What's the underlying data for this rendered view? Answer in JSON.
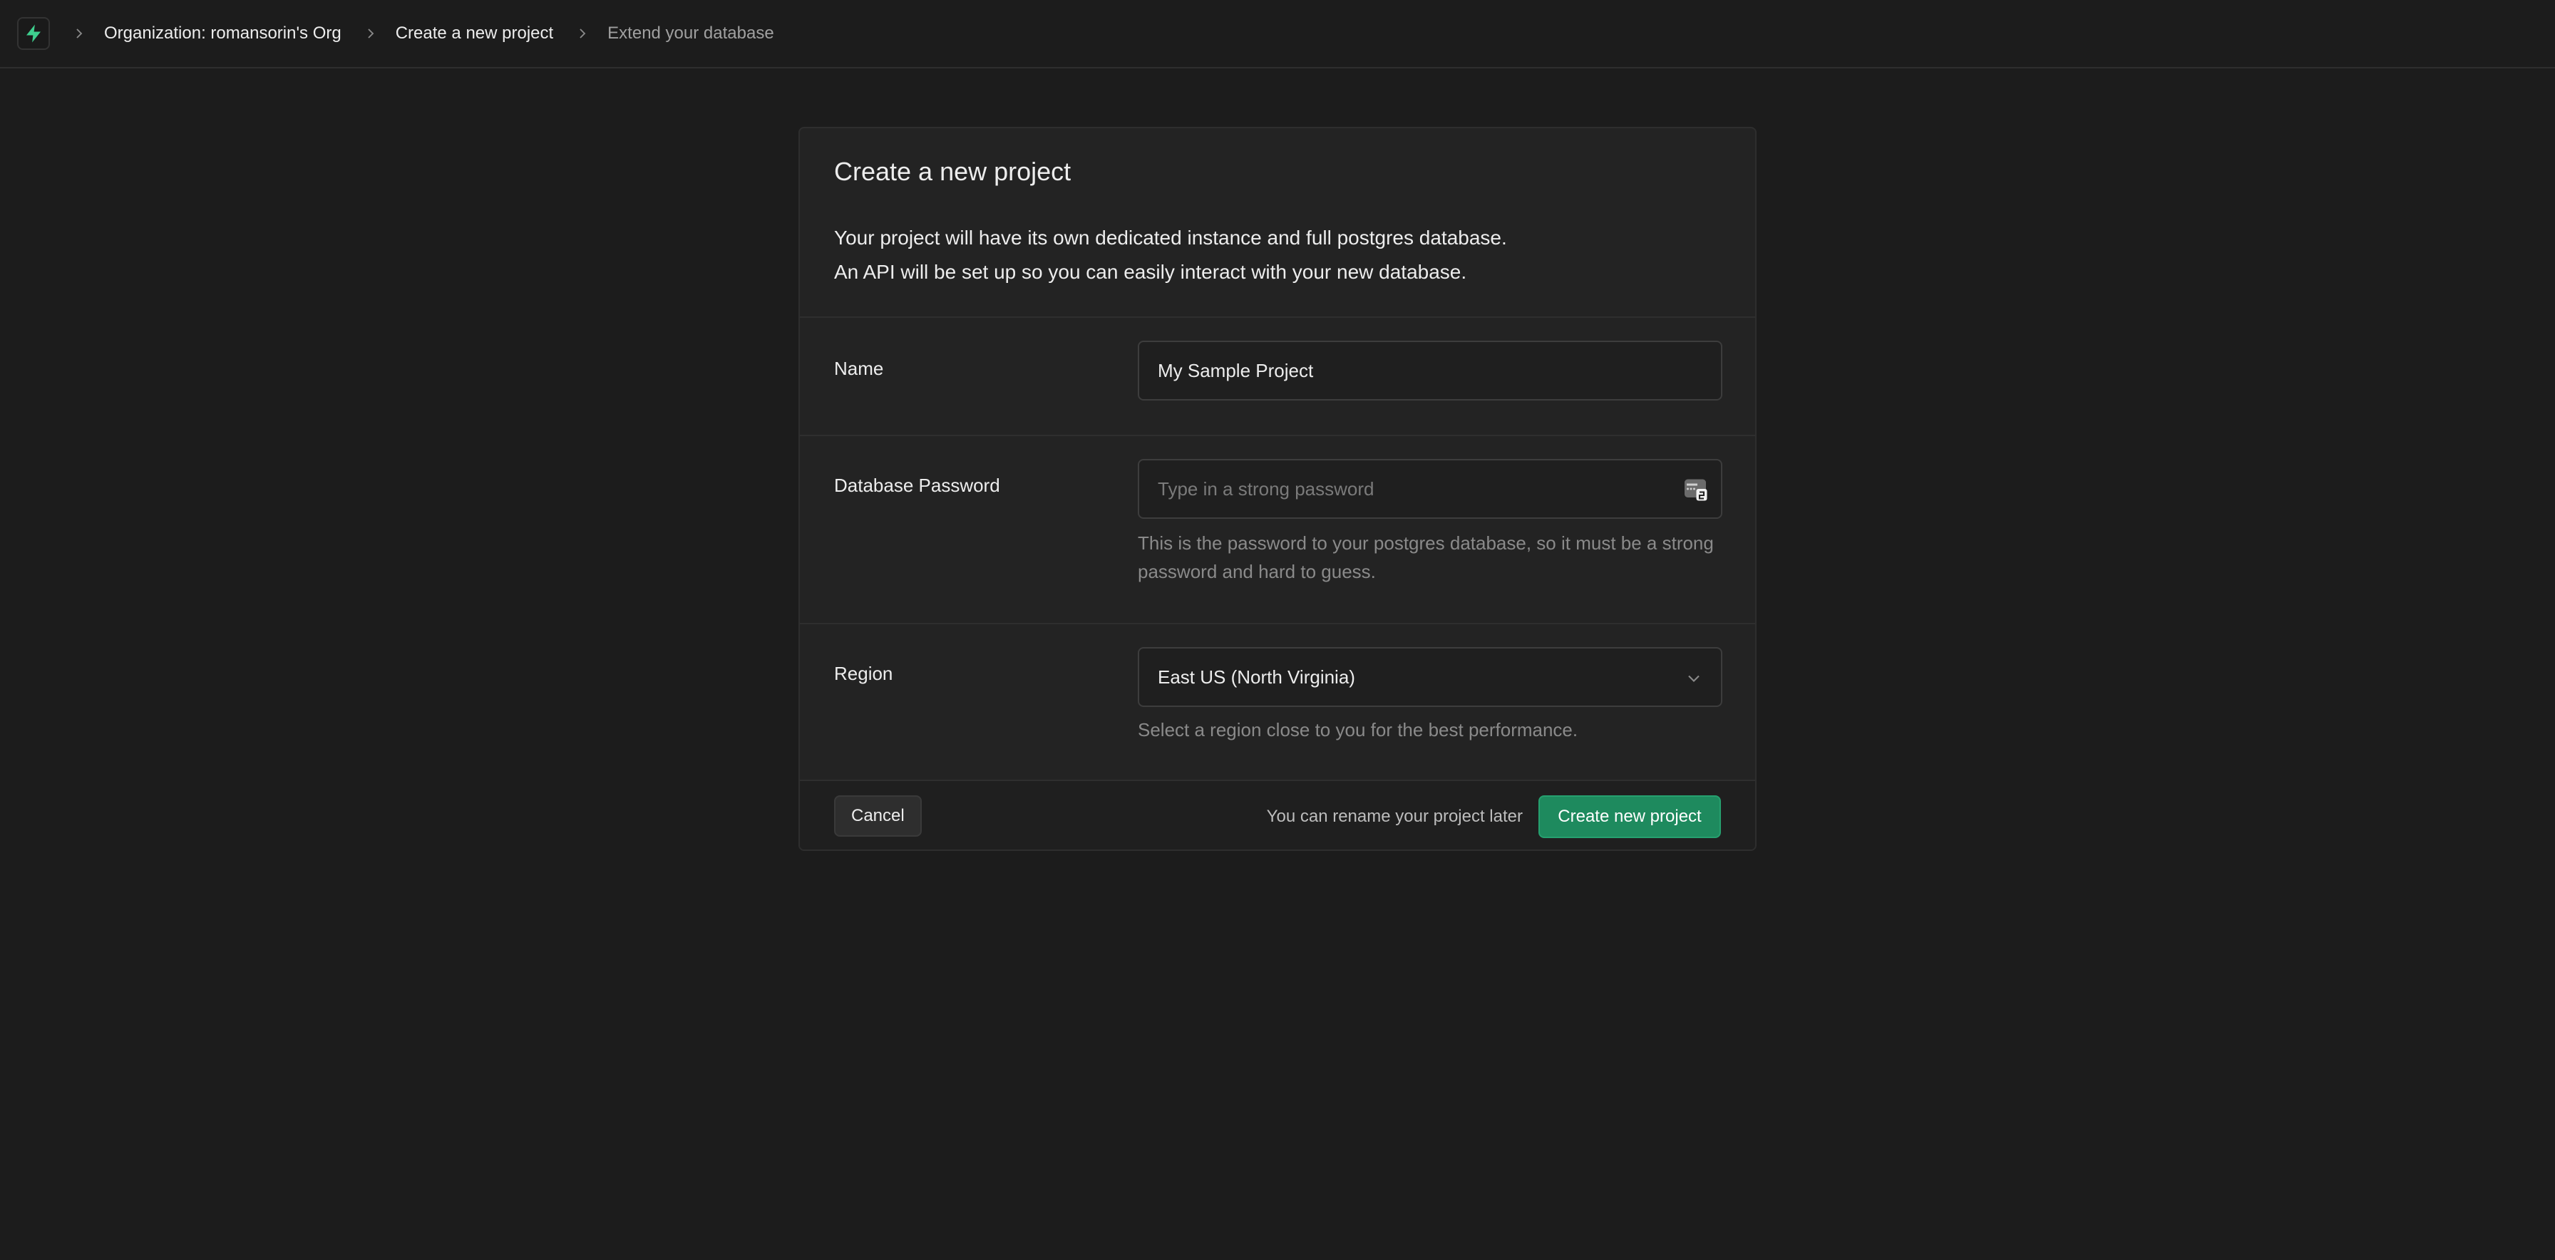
{
  "breadcrumb": {
    "items": [
      "Organization: romansorin's Org",
      "Create a new project",
      "Extend your database"
    ]
  },
  "card": {
    "title": "Create a new project",
    "description_line1": "Your project will have its own dedicated instance and full postgres database.",
    "description_line2": "An API will be set up so you can easily interact with your new database."
  },
  "form": {
    "name": {
      "label": "Name",
      "value": "My Sample Project"
    },
    "password": {
      "label": "Database Password",
      "placeholder": "Type in a strong password",
      "helper": "This is the password to your postgres database, so it must be a strong password and hard to guess."
    },
    "region": {
      "label": "Region",
      "selected": "East US (North Virginia)",
      "helper": "Select a region close to you for the best performance."
    }
  },
  "footer": {
    "cancel_label": "Cancel",
    "note": "You can rename your project later",
    "create_label": "Create new project"
  },
  "colors": {
    "brand": "#3ecf8e",
    "primary_button": "#1e8a5e",
    "background": "#1c1c1c",
    "card": "#232323"
  },
  "icons": {
    "logo": "supabase-bolt-icon",
    "separator": "chevron-right-icon",
    "password_manager": "password-key-icon",
    "dropdown": "chevron-down-icon"
  }
}
